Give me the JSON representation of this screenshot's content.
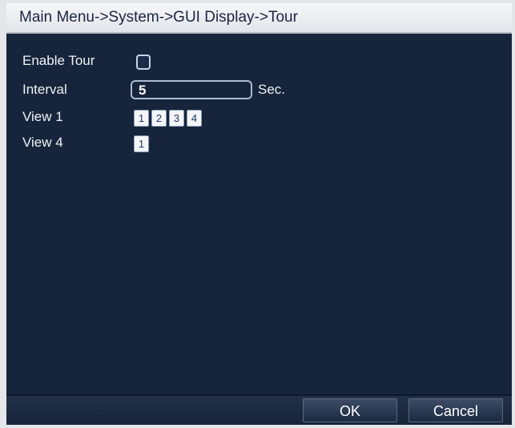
{
  "title": "Main Menu->System->GUI Display->Tour",
  "form": {
    "enable_tour_label": "Enable Tour",
    "enable_tour_checked": false,
    "interval_label": "Interval",
    "interval_value": "5",
    "interval_unit": "Sec.",
    "view1_label": "View 1",
    "view1_options": [
      "1",
      "2",
      "3",
      "4"
    ],
    "view4_label": "View 4",
    "view4_options": [
      "1"
    ]
  },
  "buttons": {
    "ok": "OK",
    "cancel": "Cancel"
  }
}
